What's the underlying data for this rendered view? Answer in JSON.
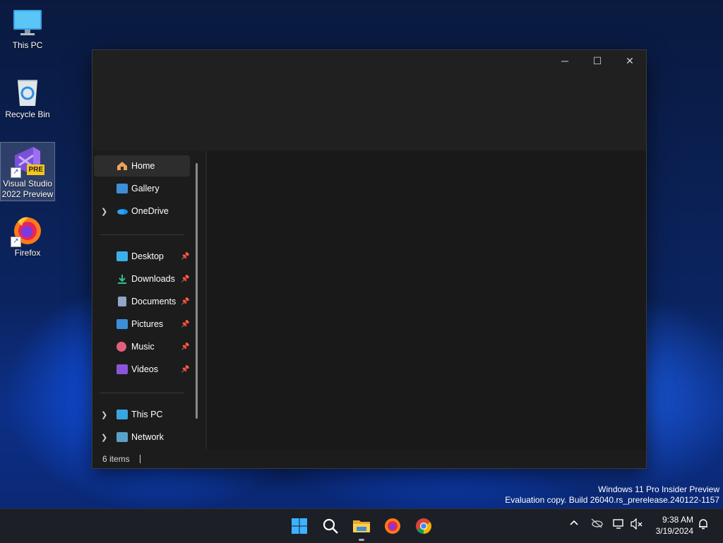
{
  "desktop": {
    "icons": [
      {
        "label1": "This PC",
        "label2": ""
      },
      {
        "label1": "Recycle Bin",
        "label2": ""
      },
      {
        "label1": "Visual Studio",
        "label2": "2022 Preview",
        "badge": "PRE"
      },
      {
        "label1": "Firefox",
        "label2": ""
      }
    ]
  },
  "explorer": {
    "controls": {
      "minimize": "─",
      "maximize": "☐",
      "close": "✕"
    },
    "nav": {
      "home": "Home",
      "gallery": "Gallery",
      "onedrive": "OneDrive",
      "desktop": "Desktop",
      "downloads": "Downloads",
      "documents": "Documents",
      "pictures": "Pictures",
      "music": "Music",
      "videos": "Videos",
      "this_pc": "This PC",
      "network": "Network"
    },
    "status": "6 items"
  },
  "watermark": {
    "line1": "Windows 11 Pro Insider Preview",
    "line2": "Evaluation copy. Build 26040.rs_prerelease.240122-1157"
  },
  "taskbar": {
    "time": "9:38 AM",
    "date": "3/19/2024",
    "apps": [
      "start-icon",
      "search-icon",
      "file-explorer-icon",
      "firefox-icon",
      "chrome-icon"
    ]
  },
  "colors": {
    "accent": "#4cc2ff",
    "window_bg": "#1c1c1c",
    "taskbar_bg": "#1c1f26"
  }
}
